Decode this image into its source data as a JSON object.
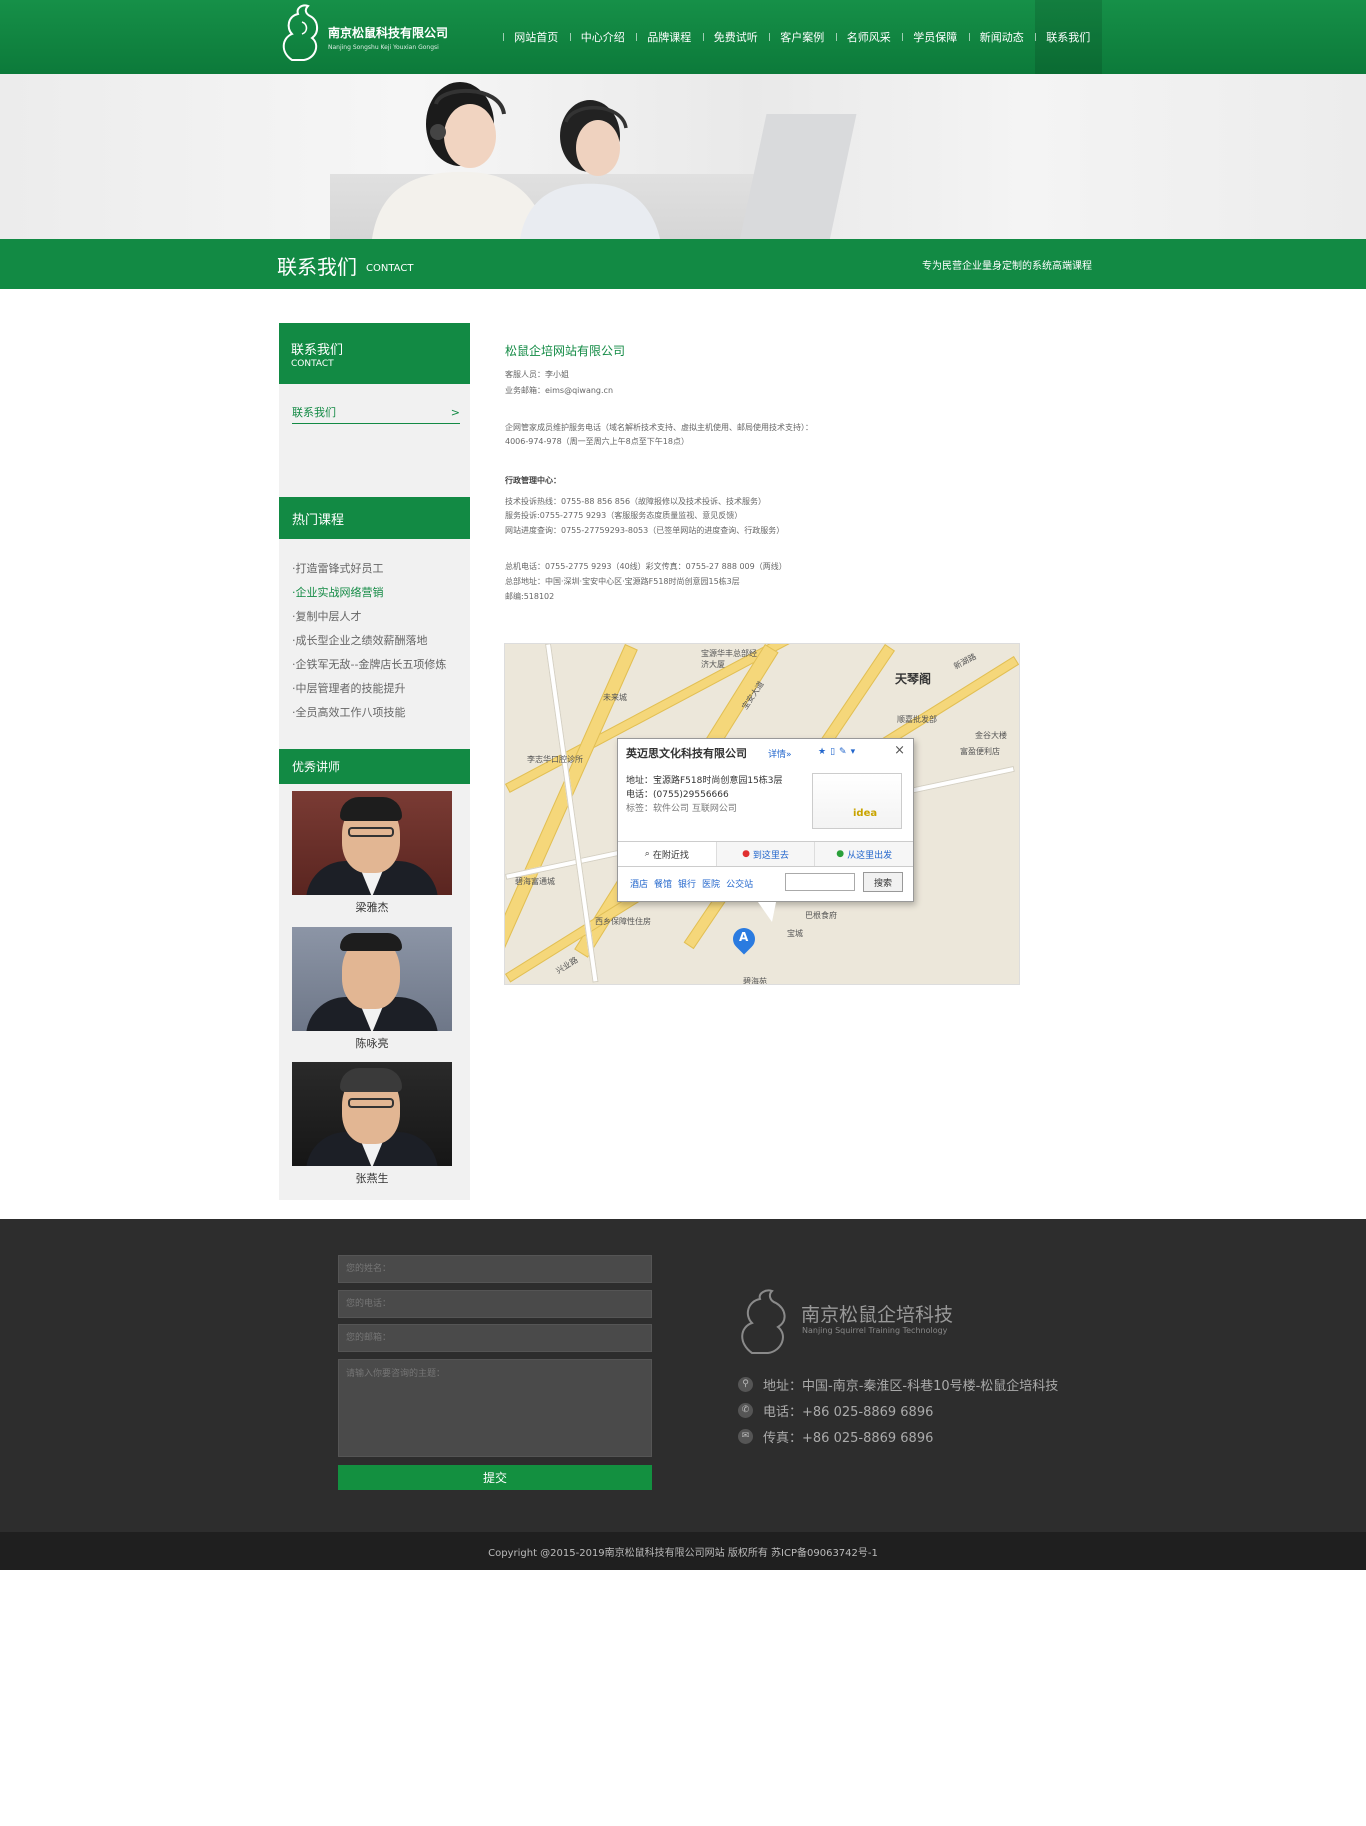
{
  "header": {
    "logo_cn": "南京松鼠科技有限公司",
    "logo_en": "Nanjing Songshu Keji Youxian Gongsi",
    "nav": [
      {
        "label": "网站首页"
      },
      {
        "label": "中心介绍"
      },
      {
        "label": "品牌课程"
      },
      {
        "label": "免费试听"
      },
      {
        "label": "客户案例"
      },
      {
        "label": "名师风采"
      },
      {
        "label": "学员保障"
      },
      {
        "label": "新闻动态"
      },
      {
        "label": "联系我们"
      }
    ],
    "active_nav": 8
  },
  "titlebar": {
    "title_cn": "联系我们",
    "title_en": "CONTACT",
    "slogan": "专为民营企业量身定制的系统高端课程"
  },
  "sidebar": {
    "head_cn": "联系我们",
    "head_en": "CONTACT",
    "link_label": "联系我们",
    "link_arrow": ">",
    "hot_title": "热门课程",
    "hot_courses": [
      "·打造雷锋式好员工",
      "·企业实战网络营销",
      "·复制中层人才",
      "·成长型企业之绩效薪酬落地",
      "·企铁军无敌--金牌店长五项修炼",
      "·中层管理者的技能提升",
      "·全员高效工作八项技能"
    ],
    "hot_active": 1,
    "teacher_title": "优秀讲师",
    "teachers": [
      {
        "name": "梁雅杰"
      },
      {
        "name": "陈咏亮"
      },
      {
        "name": "张燕生"
      }
    ]
  },
  "content": {
    "company": "松鼠企培网站有限公司",
    "lines": [
      "客服人员：李小姐",
      "业务邮箱：eims@qiwang.cn",
      "企网管家成员维护服务电话（域名解析技术支持、虚拟主机使用、邮局使用技术支持）：",
      "4006-974-978（周一至周六上午8点至下午18点）",
      "行政管理中心：",
      "技术投诉热线：0755-88 856 856（故障报修以及技术投诉、技术服务）",
      "服务投诉:0755-2775 9293（客服服务态度质量监视、意见反馈）",
      "网站进度查询：0755-27759293-8053（已签单网站的进度查询、行政服务）",
      "总机电话：0755-2775 9293（40线）彩文传真：0755-27 888 009（两线）",
      "总部地址：中国·深圳·宝安中心区·宝源路F518时尚创意园15栋3层",
      "邮编:518102"
    ]
  },
  "map": {
    "labels": [
      "天琴阁",
      "未来城",
      "李志华口腔诊所",
      "碧海富通城",
      "西乡保障性住房",
      "巴根食府",
      "宝城",
      "金谷大楼",
      "富盈便利店",
      "顺嘉批发部",
      "新湖路",
      "宝源华丰总部经济大厦",
      "碧海苑",
      "兴业路",
      "宝安大道"
    ],
    "popup": {
      "title": "英迈思文化科技有限公司",
      "detail": "详情»",
      "close": "×",
      "address": "地址：宝源路F518时尚创意园15栋3层",
      "phone": "电话：(0755)29556666",
      "tags": "标签：软件公司 互联网公司",
      "thumb_text": "idea",
      "tabs": [
        "在附近找",
        "到这里去",
        "从这里出发"
      ],
      "links": [
        "酒店",
        "餐馆",
        "银行",
        "医院",
        "公交站"
      ],
      "search_button": "搜索"
    },
    "marker": "A"
  },
  "footer": {
    "name_placeholder": "您的姓名：",
    "phone_placeholder": "您的电话：",
    "email_placeholder": "您的邮箱：",
    "message_placeholder": "请输入你要咨询的主题：",
    "submit": "提交",
    "logo_cn": "南京松鼠企培科技",
    "logo_en": "Nanjing Squirrel Training Technology",
    "address": "地址：中国-南京-秦淮区-科巷10号楼-松鼠企培科技",
    "phone": "电话：+86 025-8869 6896",
    "fax": "传真：+86 025-8869 6896"
  },
  "copyright": "Copyright @2015-2019南京松鼠科技有限公司网站 版权所有   苏ICP备09063742号-1",
  "colors": {
    "brand_green": "#128a44",
    "footer_bg": "#2d2d2d"
  }
}
